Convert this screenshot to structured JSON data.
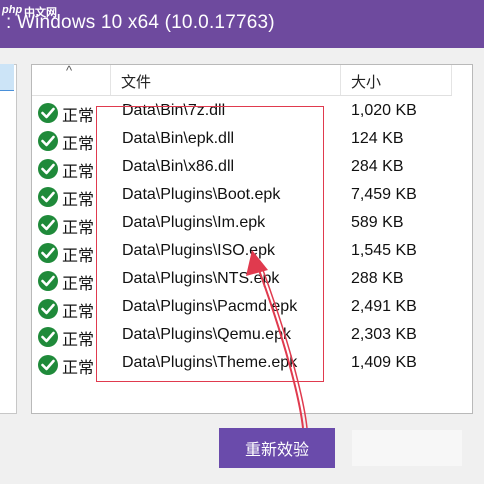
{
  "window": {
    "title": ": Windows 10 x64 (10.0.17763)"
  },
  "watermark": {
    "logo": "php",
    "text": "中文网"
  },
  "table": {
    "headers": {
      "file": "文件",
      "size": "大小"
    },
    "sort_indicator": "^",
    "rows": [
      {
        "status": "正常",
        "file": "Data\\Bin\\7z.dll",
        "size": "1,020 KB"
      },
      {
        "status": "正常",
        "file": "Data\\Bin\\epk.dll",
        "size": "124 KB"
      },
      {
        "status": "正常",
        "file": "Data\\Bin\\x86.dll",
        "size": "284 KB"
      },
      {
        "status": "正常",
        "file": "Data\\Plugins\\Boot.epk",
        "size": "7,459 KB"
      },
      {
        "status": "正常",
        "file": "Data\\Plugins\\Im.epk",
        "size": "589 KB"
      },
      {
        "status": "正常",
        "file": "Data\\Plugins\\ISO.epk",
        "size": "1,545 KB"
      },
      {
        "status": "正常",
        "file": "Data\\Plugins\\NTS.epk",
        "size": "288 KB"
      },
      {
        "status": "正常",
        "file": "Data\\Plugins\\Pacmd.epk",
        "size": "2,491 KB"
      },
      {
        "status": "正常",
        "file": "Data\\Plugins\\Qemu.epk",
        "size": "2,303 KB"
      },
      {
        "status": "正常",
        "file": "Data\\Plugins\\Theme.epk",
        "size": "1,409 KB"
      }
    ]
  },
  "buttons": {
    "reverify": "重新效验"
  },
  "colors": {
    "title_bar": "#6e4a9e",
    "button": "#6a4bab",
    "status_ok": "#1f8a3a",
    "highlight_box": "#e03a4e"
  }
}
